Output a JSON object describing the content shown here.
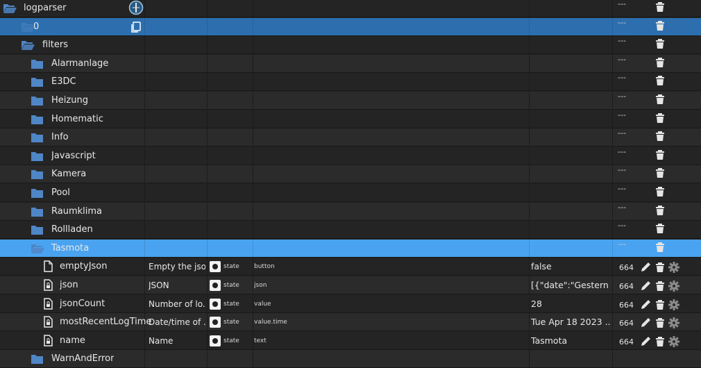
{
  "colors": {
    "background": "#232323",
    "row_alt": "#2b2b2b",
    "selected_dark": "#2d6fae",
    "selected_light": "#4aa3f0",
    "folder_icon": "#4f86c6",
    "text": "#e8e8e8"
  },
  "rows": [
    {
      "type": "folder-open",
      "name": "logparser",
      "level": 0,
      "extra_icon": "info-circle-icon",
      "dash": "---"
    },
    {
      "type": "folder-open",
      "name": "0",
      "level": 1,
      "extra_icon": "copy-icon",
      "dash": "---",
      "highlight": "dark"
    },
    {
      "type": "folder-open",
      "name": "filters",
      "level": 2,
      "dash": "---"
    },
    {
      "type": "folder",
      "name": "Alarmanlage",
      "level": 3,
      "dash": "---"
    },
    {
      "type": "folder",
      "name": "E3DC",
      "level": 3,
      "dash": "---"
    },
    {
      "type": "folder",
      "name": "Heizung",
      "level": 3,
      "dash": "---"
    },
    {
      "type": "folder",
      "name": "Homematic",
      "level": 3,
      "dash": "---"
    },
    {
      "type": "folder",
      "name": "Info",
      "level": 3,
      "dash": "---"
    },
    {
      "type": "folder",
      "name": "Javascript",
      "level": 3,
      "dash": "---"
    },
    {
      "type": "folder",
      "name": "Kamera",
      "level": 3,
      "dash": "---"
    },
    {
      "type": "folder",
      "name": "Pool",
      "level": 3,
      "dash": "---"
    },
    {
      "type": "folder",
      "name": "Raumklima",
      "level": 3,
      "dash": "---"
    },
    {
      "type": "folder",
      "name": "Rollladen",
      "level": 3,
      "dash": "---"
    },
    {
      "type": "folder-open",
      "name": "Tasmota",
      "level": 3,
      "dash": "---",
      "highlight": "light"
    },
    {
      "type": "file",
      "name": "emptyJson",
      "level": 4,
      "desc": "Empty the jso...",
      "kind": "state",
      "role": "button",
      "value": "false",
      "acl": "664"
    },
    {
      "type": "lock",
      "name": "json",
      "level": 4,
      "desc": "JSON",
      "kind": "state",
      "role": "json",
      "value": "[{\"date\":\"Gestern ...",
      "acl": "664"
    },
    {
      "type": "lock",
      "name": "jsonCount",
      "level": 4,
      "desc": "Number of lo...",
      "kind": "state",
      "role": "value",
      "value": "28",
      "acl": "664"
    },
    {
      "type": "lock",
      "name": "mostRecentLogTime",
      "level": 4,
      "desc": "Date/time of ...",
      "kind": "state",
      "role": "value.time",
      "value": "Tue Apr 18 2023 ...",
      "acl": "664"
    },
    {
      "type": "lock",
      "name": "name",
      "level": 4,
      "desc": "Name",
      "kind": "state",
      "role": "text",
      "value": "Tasmota",
      "acl": "664"
    },
    {
      "type": "folder",
      "name": "WarnAndError",
      "level": 3,
      "dash": ""
    }
  ]
}
